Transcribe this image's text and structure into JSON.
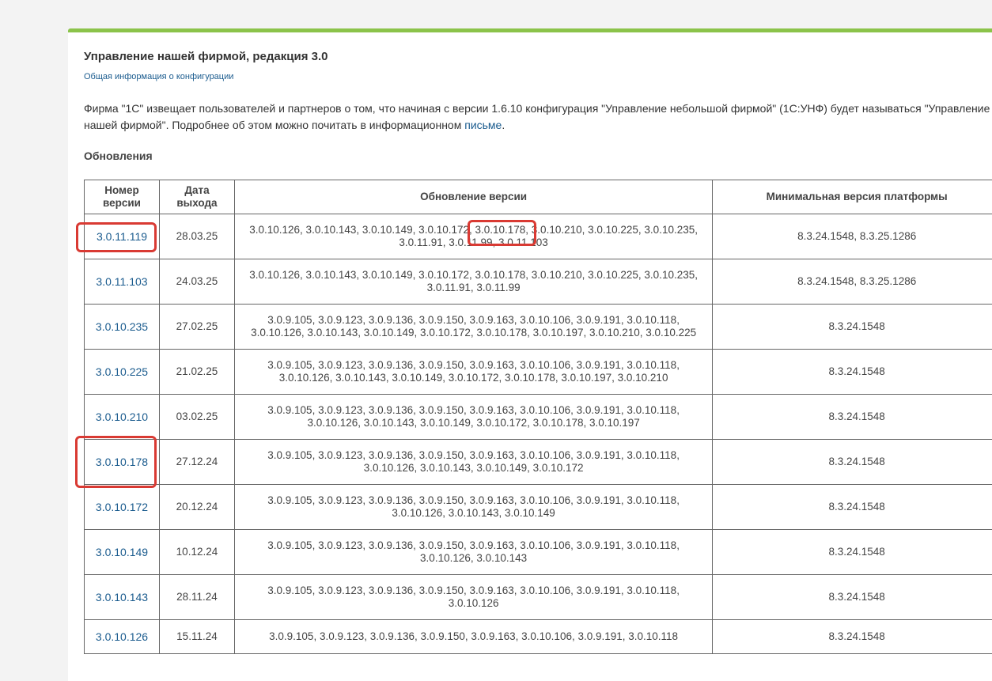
{
  "page": {
    "title": "Управление нашей фирмой, редакция 3.0",
    "info_link": "Общая информация о конфигурации",
    "desc_line1": "Фирма \"1С\" извещает пользователей и партнеров о том, что начиная с версии 1.6.10 конфигурация \"Управление небольшой фирмой\" (1С:УНФ) будет называться \"Управление",
    "desc_line2_before": "нашей фирмой\". Подробнее об этом можно почитать в информационном ",
    "desc_link": "письме",
    "desc_line2_after": ".",
    "section_title": "Обновления"
  },
  "table": {
    "headers": [
      "Номер версии",
      "Дата выхода",
      "Обновление версии",
      "Минимальная версия платформы"
    ],
    "rows": [
      {
        "version": "3.0.11.119",
        "date": "28.03.25",
        "update_l1": "3.0.10.126, 3.0.10.143, 3.0.10.149, 3.0.10.172, 3.0.10.178, 3.0.10.210, 3.0.10.225, 3.0.10.235,",
        "update_l2": "3.0.11.91, 3.0.11.99, 3.0.11.103",
        "platform": "8.3.24.1548, 8.3.25.1286"
      },
      {
        "version": "3.0.11.103",
        "date": "24.03.25",
        "update_l1": "3.0.10.126, 3.0.10.143, 3.0.10.149, 3.0.10.172, 3.0.10.178, 3.0.10.210, 3.0.10.225, 3.0.10.235,",
        "update_l2": "3.0.11.91, 3.0.11.99",
        "platform": "8.3.24.1548, 8.3.25.1286"
      },
      {
        "version": "3.0.10.235",
        "date": "27.02.25",
        "update_l1": "3.0.9.105, 3.0.9.123, 3.0.9.136, 3.0.9.150, 3.0.9.163, 3.0.10.106, 3.0.9.191, 3.0.10.118,",
        "update_l2": "3.0.10.126, 3.0.10.143, 3.0.10.149, 3.0.10.172, 3.0.10.178, 3.0.10.197, 3.0.10.210, 3.0.10.225",
        "platform": "8.3.24.1548"
      },
      {
        "version": "3.0.10.225",
        "date": "21.02.25",
        "update_l1": "3.0.9.105, 3.0.9.123, 3.0.9.136, 3.0.9.150, 3.0.9.163, 3.0.10.106, 3.0.9.191, 3.0.10.118,",
        "update_l2": "3.0.10.126, 3.0.10.143, 3.0.10.149, 3.0.10.172, 3.0.10.178, 3.0.10.197, 3.0.10.210",
        "platform": "8.3.24.1548"
      },
      {
        "version": "3.0.10.210",
        "date": "03.02.25",
        "update_l1": "3.0.9.105, 3.0.9.123, 3.0.9.136, 3.0.9.150, 3.0.9.163, 3.0.10.106, 3.0.9.191, 3.0.10.118,",
        "update_l2": "3.0.10.126, 3.0.10.143, 3.0.10.149, 3.0.10.172, 3.0.10.178, 3.0.10.197",
        "platform": "8.3.24.1548"
      },
      {
        "version": "3.0.10.178",
        "date": "27.12.24",
        "update_l1": "3.0.9.105, 3.0.9.123, 3.0.9.136, 3.0.9.150, 3.0.9.163, 3.0.10.106, 3.0.9.191, 3.0.10.118,",
        "update_l2": "3.0.10.126, 3.0.10.143, 3.0.10.149, 3.0.10.172",
        "platform": "8.3.24.1548"
      },
      {
        "version": "3.0.10.172",
        "date": "20.12.24",
        "update_l1": "3.0.9.105, 3.0.9.123, 3.0.9.136, 3.0.9.150, 3.0.9.163, 3.0.10.106, 3.0.9.191, 3.0.10.118,",
        "update_l2": "3.0.10.126, 3.0.10.143, 3.0.10.149",
        "platform": "8.3.24.1548"
      },
      {
        "version": "3.0.10.149",
        "date": "10.12.24",
        "update_l1": "3.0.9.105, 3.0.9.123, 3.0.9.136, 3.0.9.150, 3.0.9.163, 3.0.10.106, 3.0.9.191, 3.0.10.118,",
        "update_l2": "3.0.10.126, 3.0.10.143",
        "platform": "8.3.24.1548"
      },
      {
        "version": "3.0.10.143",
        "date": "28.11.24",
        "update_l1": "3.0.9.105, 3.0.9.123, 3.0.9.136, 3.0.9.150, 3.0.9.163, 3.0.10.106, 3.0.9.191, 3.0.10.118,",
        "update_l2": "3.0.10.126",
        "platform": "8.3.24.1548"
      },
      {
        "version": "3.0.10.126",
        "date": "15.11.24",
        "update_l1": "3.0.9.105, 3.0.9.123, 3.0.9.136, 3.0.9.150, 3.0.9.163, 3.0.10.106, 3.0.9.191, 3.0.10.118",
        "update_l2": "",
        "platform": "8.3.24.1548"
      }
    ]
  },
  "colors": {
    "accent_bar": "#8bc34a",
    "link": "#1a5b8e",
    "highlight": "#d93a33"
  }
}
